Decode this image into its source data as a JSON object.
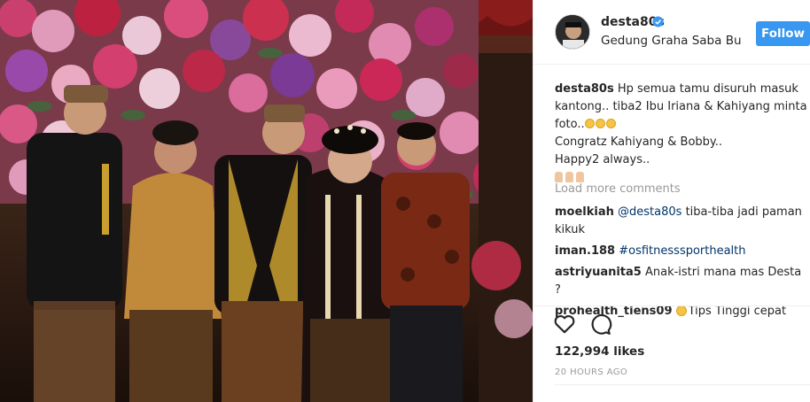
{
  "post": {
    "username": "desta80s",
    "location": "Gedung Graha Saba Bu...",
    "follow_label": "Follow",
    "colors": {
      "accent": "#3897f0",
      "verified": "#3897f0",
      "muted": "#999999"
    }
  },
  "caption": {
    "user": "desta80s",
    "line1": "Hp semua tamu disuruh masuk",
    "line2": "kantong.. tiba2 Ibu Iriana & Kahiyang minta",
    "line3": "foto..",
    "line4": "Congratz Kahiyang & Bobby..",
    "line5": "Happy2 always..",
    "emoji_after_foto": "smiling-face-icons",
    "emoji_last_line": "folded-hands-icons"
  },
  "load_more": "Load more comments",
  "comments": [
    {
      "user": "moelkiah",
      "tag": "@desta80s",
      "text": " tiba-tiba jadi paman kikuk"
    },
    {
      "user": "iman.188",
      "tag": "#osfitnesssporthealth",
      "text": ""
    },
    {
      "user": "astriyuanita5",
      "tag": "",
      "text": "Anak-istri mana mas Desta ?"
    },
    {
      "user": "prohealth_tiens09",
      "tag": "",
      "text": "Tips Tinggi cepat"
    }
  ],
  "likes": "122,994 likes",
  "time": "20 HOURS AGO"
}
